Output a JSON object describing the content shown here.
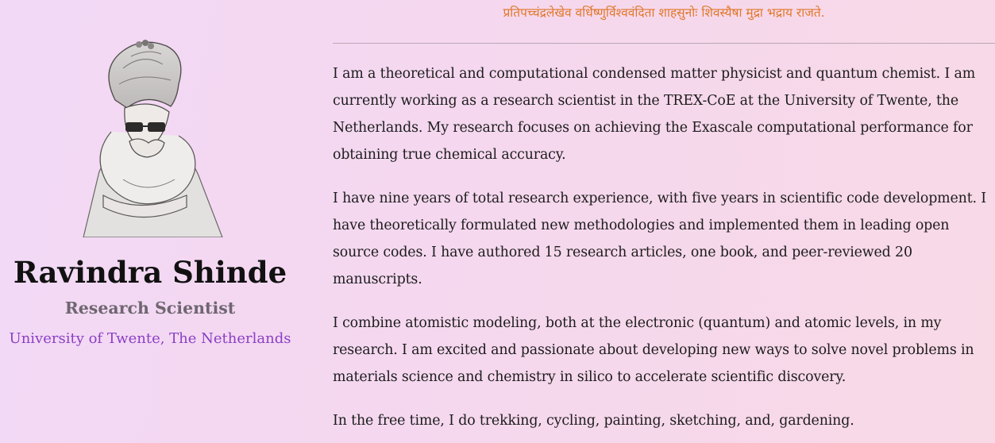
{
  "header": {
    "motto": "प्रतिपच्चंद्रलेखेव वर्धिष्णुर्विश्ववंदिता शाहसुनोः शिवस्यैषा मुद्रा भद्राय राजते."
  },
  "profile": {
    "name": "Ravindra Shinde",
    "role": "Research Scientist",
    "affiliation": "University of Twente, The Netherlands",
    "portrait_icon": "pencil-sketch-portrait"
  },
  "about": {
    "paragraphs": [
      "I am a theoretical and computational condensed matter physicist and quantum chemist. I am currently working as a research scientist in the TREX-CoE at the University of Twente, the Netherlands. My research focuses on achieving the Exascale computational performance for obtaining true chemical accuracy.",
      "I have nine years of total research experience, with five years in scientific code development. I have theoretically formulated new methodologies and implemented them in leading open source codes. I have authored 15 research articles, one book, and peer-reviewed 20 manuscripts.",
      "I combine atomistic modeling, both at the electronic (quantum) and atomic levels, in my research. I am excited and passionate about developing new ways to solve novel problems in materials science and chemistry in silico to accelerate scientific discovery.",
      "In the free time, I do trekking, cycling, painting, sketching, and, gardening."
    ]
  },
  "colors": {
    "motto": "#e0782a",
    "affiliation": "#8a3fc4",
    "role": "#6f6670"
  }
}
